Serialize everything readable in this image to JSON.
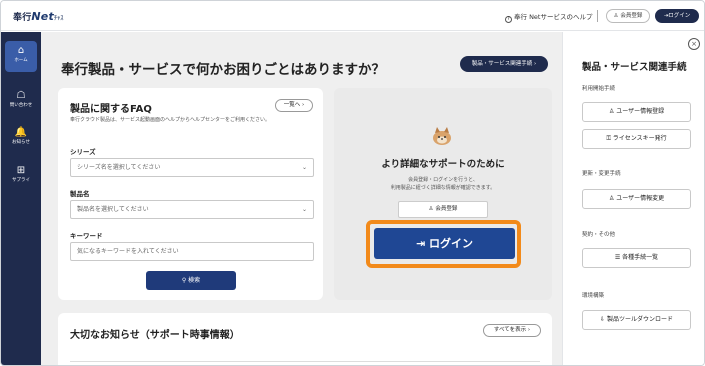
{
  "header": {
    "logo_prefix": "奉行",
    "logo_net": "Net",
    "logo_suffix": "ﾁｬｽ",
    "help_link": "奉行 Netサービスのヘルプ",
    "register_btn": "会員登録",
    "login_btn": "ログイン"
  },
  "leftnav": {
    "items": [
      {
        "icon": "⌂",
        "label": "ホーム"
      },
      {
        "icon": "☖",
        "label": "問い合わせ"
      },
      {
        "icon": "🔔",
        "label": "お知らせ"
      },
      {
        "icon": "⊞",
        "label": "サプライ"
      }
    ]
  },
  "main": {
    "title": "奉行製品・サービスで何かお困りごとはありますか？",
    "related_btn": "製品・サービス関連手続 ›",
    "faq": {
      "title": "製品に関するFAQ",
      "list_btn": "一覧へ ›",
      "desc": "奉行クラウド製品は、サービス起動画面のヘルプからヘルプセンターをご利用ください。",
      "series_label": "シリーズ",
      "series_placeholder": "シリーズ名を選択してください",
      "product_label": "製品名",
      "product_placeholder": "製品名を選択してください",
      "keyword_label": "キーワード",
      "keyword_placeholder": "気になるキーワードを入れてください",
      "search_btn": "検索"
    },
    "support": {
      "title": "より詳細なサポートのために",
      "desc1": "会員登録・ログインを行うと、",
      "desc2": "利用製品に紐づく詳細な情報が確認できます。",
      "register_btn": "会員登録",
      "login_btn": "ログイン"
    },
    "news": {
      "title": "大切なお知らせ（サポート時事情報）",
      "all_btn": "すべてを表示 ›"
    }
  },
  "rightpanel": {
    "title": "製品・サービス関連手続",
    "sections": [
      {
        "label": "利用開始手続",
        "buttons": [
          "ユーザー情報登録",
          "ライセンスキー発行"
        ]
      },
      {
        "label": "更新・変更手続",
        "buttons": [
          "ユーザー情報変更"
        ]
      },
      {
        "label": "契約・その他",
        "buttons": [
          "各種手続一覧"
        ]
      },
      {
        "label": "環境構築",
        "buttons": [
          "製品ツールダウンロード"
        ]
      }
    ]
  },
  "colors": {
    "nav_bg": "#1f2b4d",
    "accent_blue": "#1f4794",
    "highlight_orange": "#f28a1a",
    "main_bg": "#efefef"
  }
}
